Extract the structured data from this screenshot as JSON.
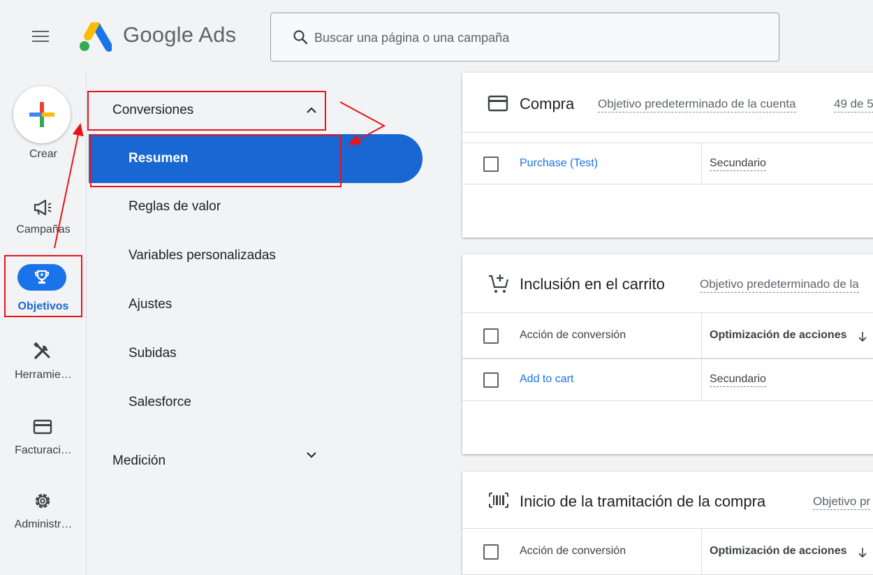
{
  "header": {
    "brand": "Google Ads",
    "search_placeholder": "Buscar una página o una campaña"
  },
  "rail": {
    "create_label": "Crear",
    "items": [
      {
        "label": "Campañas",
        "icon": "megaphone-icon"
      },
      {
        "label": "Objetivos",
        "icon": "trophy-icon"
      },
      {
        "label": "Herramie…",
        "icon": "tools-icon"
      },
      {
        "label": "Facturaci…",
        "icon": "credit-card-icon"
      },
      {
        "label": "Administr…",
        "icon": "gear-icon"
      }
    ]
  },
  "subnav": {
    "group1": "Conversiones",
    "items": [
      "Resumen",
      "Reglas de valor",
      "Variables personalizadas",
      "Ajustes",
      "Subidas",
      "Salesforce"
    ],
    "group2": "Medición"
  },
  "cards": [
    {
      "title": "Compra",
      "subtitle": "Objetivo predeterminado de la cuenta",
      "extra": "49 de 5",
      "rows": [
        {
          "action": "Purchase (Test)",
          "optimization": "Secundario"
        }
      ]
    },
    {
      "title": "Inclusión en el carrito",
      "subtitle": "Objetivo predeterminado de la",
      "header": {
        "action": "Acción de conversión",
        "optimization": "Optimización de acciones"
      },
      "rows": [
        {
          "action": "Add to cart",
          "optimization": "Secundario"
        }
      ]
    },
    {
      "title": "Inicio de la tramitación de la compra",
      "subtitle": "Objetivo pr",
      "header": {
        "action": "Acción de conversión",
        "optimization": "Optimización de acciones"
      }
    }
  ],
  "colors": {
    "accent": "#1a73e8",
    "active_nav": "#1967d2",
    "annotation": "#e8141a",
    "background": "#f1f3f4"
  }
}
